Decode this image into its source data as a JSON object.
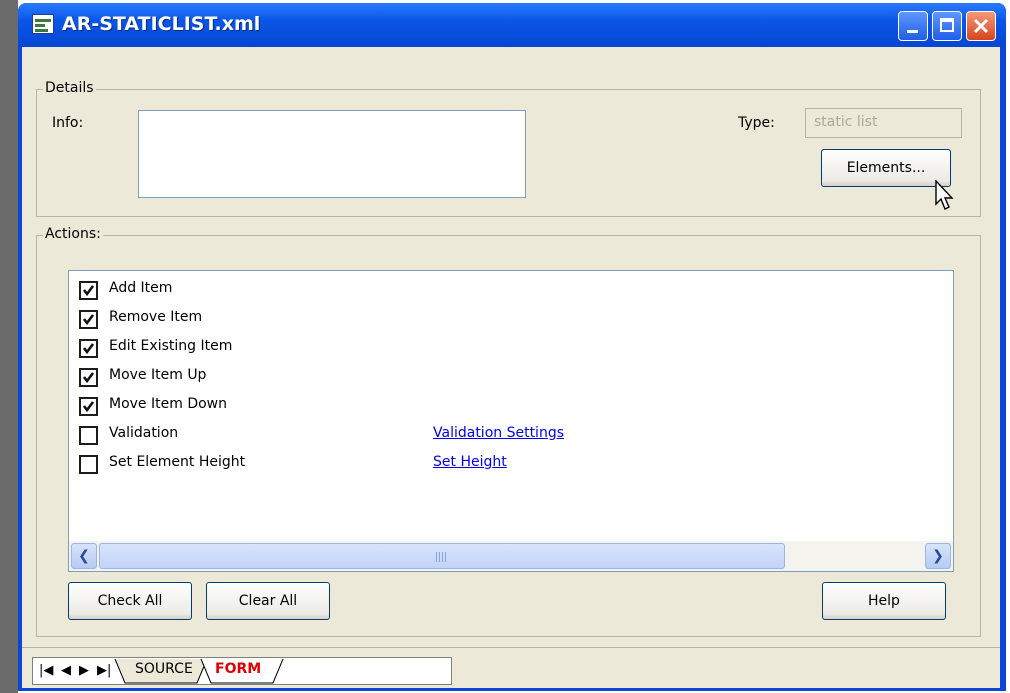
{
  "window": {
    "title": "AR-STATICLIST.xml"
  },
  "details": {
    "legend": "Details",
    "info_label": "Info:",
    "info_value": "",
    "type_label": "Type:",
    "type_value": "static list",
    "elements_button": "Elements..."
  },
  "actions": {
    "legend": "Actions:",
    "items": [
      {
        "label": "Add Item",
        "checked": true,
        "link": ""
      },
      {
        "label": "Remove Item",
        "checked": true,
        "link": ""
      },
      {
        "label": "Edit Existing Item",
        "checked": true,
        "link": ""
      },
      {
        "label": "Move Item Up",
        "checked": true,
        "link": ""
      },
      {
        "label": "Move Item Down",
        "checked": true,
        "link": ""
      },
      {
        "label": "Validation",
        "checked": false,
        "link": "Validation Settings"
      },
      {
        "label": "Set Element Height",
        "checked": false,
        "link": "Set Height"
      }
    ],
    "check_all": "Check All",
    "clear_all": "Clear All",
    "help": "Help"
  },
  "tabs": {
    "nav": [
      "|◀",
      "◀",
      "▶",
      "▶|"
    ],
    "items": [
      "SOURCE",
      "FORM"
    ],
    "active": "FORM",
    "active_color": "#e00000"
  },
  "colors": {
    "titlebar": "#0a56e8",
    "face": "#ece9d8",
    "link": "#0000ee"
  }
}
